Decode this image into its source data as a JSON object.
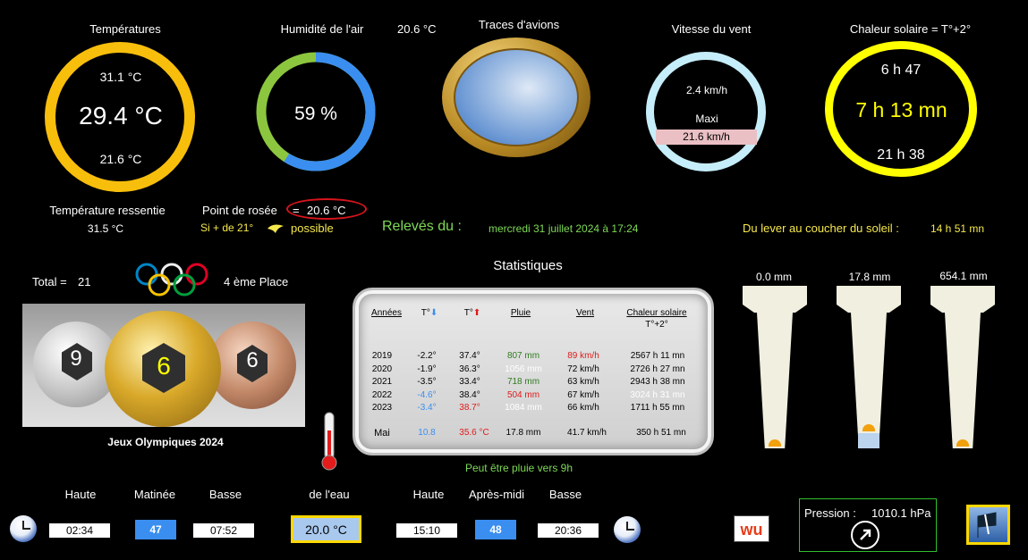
{
  "temperatures": {
    "title": "Températures",
    "max": "31.1 °C",
    "current": "29.4 °C",
    "min": "21.6 °C"
  },
  "humidity": {
    "title": "Humidité de l'air",
    "value": "59 %",
    "percent": 59,
    "side_temp": "20.6 °C"
  },
  "planes": {
    "title": "Traces d'avions"
  },
  "wind": {
    "title": "Vitesse du vent",
    "current": "2.4 km/h",
    "max_label": "Maxi",
    "max": "21.6 km/h"
  },
  "solar": {
    "title": "Chaleur solaire = T°+2°",
    "sunrise": "6 h 47",
    "duration": "7 h 13 mn",
    "sunset": "21 h 38"
  },
  "feels": {
    "label": "Température ressentie",
    "value": "31.5 °C"
  },
  "dew": {
    "label": "Point de rosée",
    "eq": "=",
    "value": "20.6 °C",
    "cond": "Si + de 21°",
    "possible": "possible"
  },
  "readings": {
    "label": "Relevés du :",
    "date": "mercredi 31 juillet 2024 à 17:24"
  },
  "daylight": {
    "label": "Du lever au coucher du soleil :",
    "value": "14 h 51 mn"
  },
  "olympics": {
    "total_label": "Total =",
    "total": "21",
    "place": "4 ème Place",
    "silver": "9",
    "gold": "6",
    "bronze": "6",
    "caption": "Jeux Olympiques 2024"
  },
  "stats": {
    "title": "Statistiques",
    "headers": {
      "year": "Années",
      "tmin": "T°",
      "tmax": "T°",
      "rain": "Pluie",
      "wind": "Vent",
      "solar": "Chaleur solaire",
      "solar_sub": "T°+2°"
    },
    "rows": [
      {
        "year": "2019",
        "tmin": "-2.2°",
        "tmax": "37.4°",
        "rain": "807 mm",
        "wind": "89 km/h",
        "solar": "2567 h 11 mn"
      },
      {
        "year": "2020",
        "tmin": "-1.9°",
        "tmax": "36.3°",
        "rain": "1056 mm",
        "wind": "72 km/h",
        "solar": "2726 h 27 mn"
      },
      {
        "year": "2021",
        "tmin": "-3.5°",
        "tmax": "33.4°",
        "rain": "718 mm",
        "wind": "63 km/h",
        "solar": "2943 h 38 mn"
      },
      {
        "year": "2022",
        "tmin": "-4.6°",
        "tmax": "38.4°",
        "rain": "504 mm",
        "wind": "67 km/h",
        "solar": "3024 h 31 mn"
      },
      {
        "year": "2023",
        "tmin": "-3.4°",
        "tmax": "38.7°",
        "rain": "1084 mm",
        "wind": "66 km/h",
        "solar": "1711 h 55 mn"
      }
    ],
    "month": {
      "label": "Mai",
      "tmin": "10.8",
      "tmax": "35.6 °C",
      "rain": "17.8 mm",
      "wind": "41.7 km/h",
      "solar": "350 h 51 mn"
    },
    "forecast": "Peut être pluie vers 9h"
  },
  "rain": [
    {
      "value": "0.0 mm",
      "fill": 0.0
    },
    {
      "value": "17.8 mm",
      "fill": 0.11
    },
    {
      "value": "654.1 mm",
      "fill": 0.0
    }
  ],
  "tides": {
    "morning": {
      "high_label": "Haute",
      "label": "Matinée",
      "low_label": "Basse",
      "high": "02:34",
      "coef": "47",
      "low": "07:52"
    },
    "water": {
      "label": "de l'eau",
      "value": "20.0 °C"
    },
    "afternoon": {
      "high_label": "Haute",
      "label": "Après-midi",
      "low_label": "Basse",
      "high": "15:10",
      "coef": "48",
      "low": "20:36"
    }
  },
  "pressure": {
    "label": "Pression :",
    "value": "1010.1 hPa"
  },
  "logo": {
    "text": "wu"
  },
  "colors": {
    "temp_ring": "#f8be0c",
    "solar_ring": "#ffff00",
    "wind_ring": "#c5eefa",
    "humidity_blue": "#3a8ef0",
    "humidity_green": "#8cc63f",
    "yellow_text": "#f6e94c",
    "green_text": "#7ed957",
    "red_circle": "#d8141c"
  },
  "icons": [
    "clock-icon",
    "thermometer-icon",
    "weather-bird-icon",
    "arrow-up-right-icon",
    "rain-flag-icon"
  ]
}
